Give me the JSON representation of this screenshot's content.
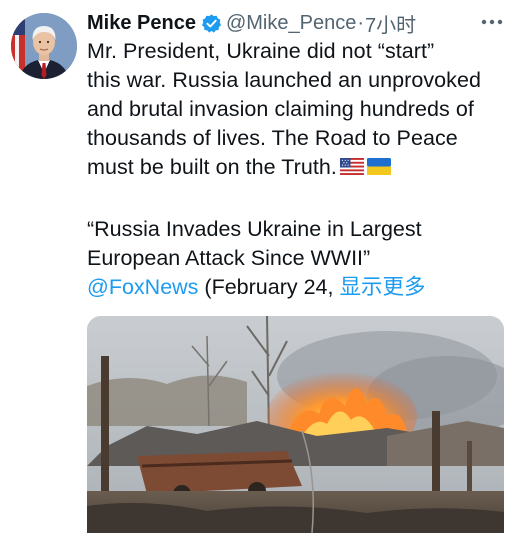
{
  "tweet": {
    "author_name": "Mike Pence",
    "handle": "@Mike_Pence",
    "separator": "·",
    "time": "7小时",
    "text_lines": [
      "Mr. President, Ukraine did not “start”",
      "this war. Russia launched an unprovoked",
      "and brutal invasion claiming hundreds of",
      "thousands of lives. The Road to Peace",
      "must be built on the Truth."
    ],
    "flags": [
      "us-flag-icon",
      "ukraine-flag-icon"
    ],
    "quote_lines": [
      "“Russia Invades Ukraine in Largest",
      "European Attack Since WWII”"
    ],
    "mention": "@FoxNews",
    "date_text": " (February 24, ",
    "show_more": "显示更多"
  },
  "colors": {
    "link": "#1d9bf0",
    "secondary_text": "#536471",
    "verified_badge": "#1d9bf0"
  },
  "icons": {
    "verified": "verified-badge-icon",
    "more": "more-options-icon"
  }
}
